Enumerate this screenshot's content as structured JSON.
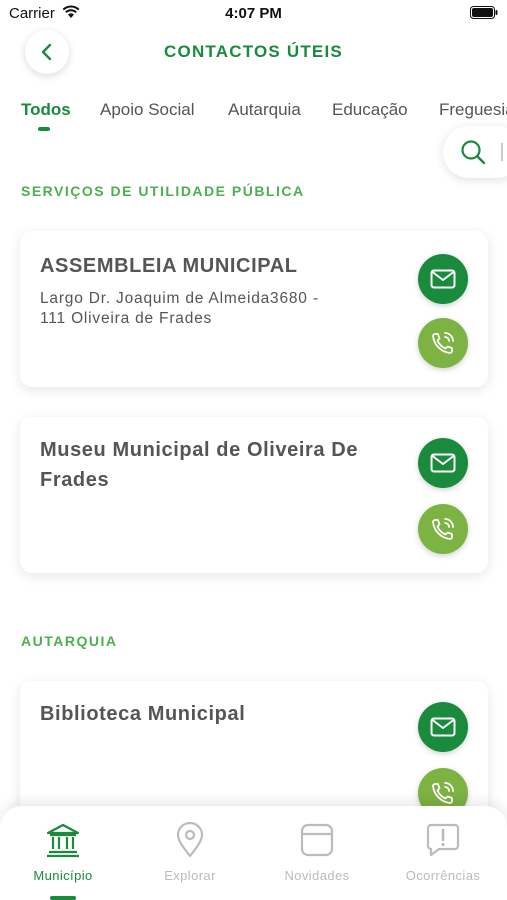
{
  "status_bar": {
    "carrier": "Carrier",
    "time": "4:07 PM"
  },
  "header": {
    "title": "CONTACTOS ÚTEIS",
    "back_icon": "chevron-left-icon"
  },
  "tabs": [
    "Todos",
    "Apoio Social",
    "Autarquia",
    "Educação",
    "Freguesias"
  ],
  "active_tab": "Todos",
  "search": {
    "icon": "search-icon"
  },
  "sections": [
    {
      "title": "SERVIÇOS DE UTILIDADE PÚBLICA",
      "cards": [
        {
          "name": "ASSEMBLEIA MUNICIPAL",
          "address": "Largo Dr. Joaquim de Almeida3680 - 111 Oliveira de Frades"
        },
        {
          "name": "Museu Municipal de Oliveira De Frades",
          "address": ""
        }
      ]
    },
    {
      "title": "AUTARQUIA",
      "cards": [
        {
          "name": "Biblioteca Municipal",
          "address": ""
        }
      ]
    }
  ],
  "bottom_nav": [
    {
      "label": "Município",
      "icon": "town-hall-icon",
      "active": true
    },
    {
      "label": "Explorar",
      "icon": "location-pin-icon",
      "active": false
    },
    {
      "label": "Novidades",
      "icon": "news-icon",
      "active": false
    },
    {
      "label": "Ocorrências",
      "icon": "alert-message-icon",
      "active": false
    }
  ],
  "colors": {
    "primary": "#1a8a3c",
    "phone": "#7cb342",
    "section": "#4caf50",
    "text": "#555555",
    "inactive": "#bbbbbb"
  }
}
